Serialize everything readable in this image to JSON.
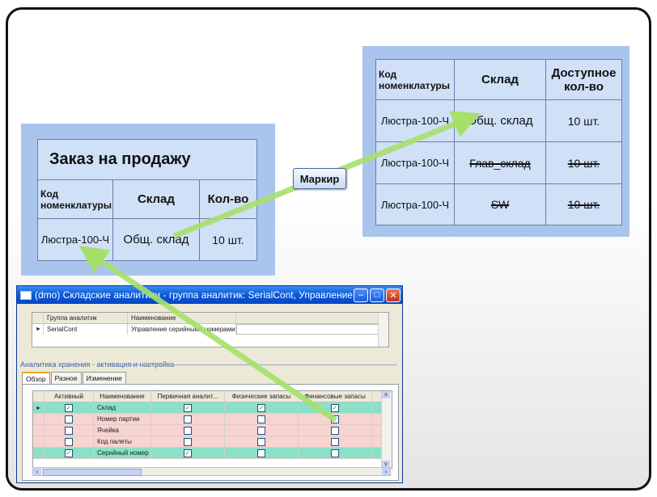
{
  "sales_order": {
    "title": "Заказ на продажу",
    "headers": [
      "Код номенклатуры",
      "Склад",
      "Кол-во"
    ],
    "row": [
      "Люстра-100-Ч",
      "Общ. склад",
      "10 шт."
    ]
  },
  "marker_label": "Маркир",
  "availability": {
    "headers": [
      "Код номенклатуры",
      "Склад",
      "Доступное кол-во"
    ],
    "rows": [
      [
        "Люстра-100-Ч",
        "Общ. склад",
        "10 шт."
      ],
      [
        "Люстра-100-Ч",
        "Глав_склад",
        "10 шт."
      ],
      [
        "Люстра-100-Ч",
        "SW",
        "10 шт."
      ]
    ]
  },
  "window": {
    "title": "(dmo) Складские аналитики - группа аналитик: SerialCont, Управление серийным...",
    "group_grid": {
      "headers": [
        "Группа аналитик",
        "Наименование"
      ],
      "row": [
        "SerialCont",
        "Управление серийными номерами"
      ]
    },
    "section_title": "Аналитика хранения - активация и настройка",
    "tabs": [
      "Обзор",
      "Разное",
      "Изменение"
    ],
    "grid": {
      "headers": [
        "Активный",
        "Наименование",
        "Первичная аналит...",
        "Физические запасы",
        "Финансовые запасы"
      ],
      "rows": [
        {
          "active": true,
          "name": "Склад",
          "primary": true,
          "physical": true,
          "financial": true,
          "highlight": true
        },
        {
          "active": false,
          "name": "Номер партии",
          "primary": false,
          "physical": false,
          "financial": false,
          "highlight": false
        },
        {
          "active": false,
          "name": "Ячейка",
          "primary": false,
          "physical": false,
          "financial": false,
          "highlight": false
        },
        {
          "active": false,
          "name": "Код палеты",
          "primary": false,
          "physical": false,
          "financial": false,
          "highlight": false
        },
        {
          "active": true,
          "name": "Серийный номер",
          "primary": true,
          "physical": false,
          "financial": false,
          "highlight": true
        }
      ]
    }
  },
  "colors": {
    "panel_outer": "#a9c5ee",
    "panel_inner": "#cfe0f7",
    "arrow": "#a6e06a",
    "row_active": "#8be0c8",
    "row_inactive": "#f7d4d0"
  }
}
